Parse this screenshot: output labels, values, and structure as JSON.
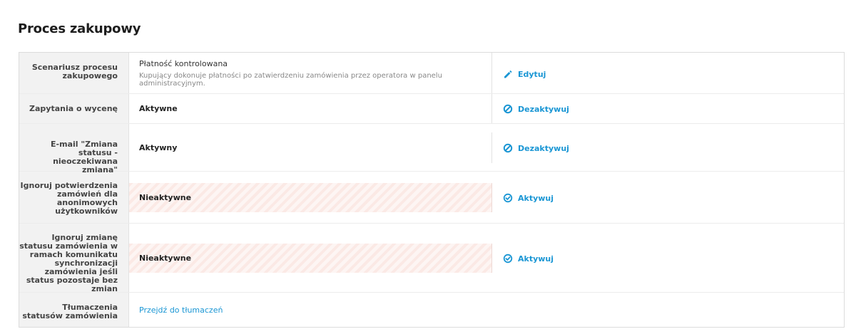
{
  "page": {
    "title": "Proces zakupowy"
  },
  "rows": [
    {
      "label": "Scenariusz procesu zakupowego",
      "value_title": "Płatność kontrolowana",
      "value_desc": "Kupujący dokonuje płatności po zatwierdzeniu zamówienia przez operatora w panelu administracyjnym.",
      "action_label": "Edytuj",
      "action_icon": "pencil-icon"
    },
    {
      "label": "Zapytania o wycenę",
      "value": "Aktywne",
      "action_label": "Dezaktywuj",
      "action_icon": "block-icon"
    },
    {
      "label": "E-mail \"Zmiana statusu - nieoczekiwana zmiana\"",
      "value": "Aktywny",
      "action_label": "Dezaktywuj",
      "action_icon": "block-icon"
    },
    {
      "label": "Ignoruj potwierdzenia zamówień dla anonimowych użytkowników",
      "value": "Nieaktywne",
      "action_label": "Aktywuj",
      "action_icon": "check-circle-icon"
    },
    {
      "label": "Ignoruj zmianę statusu zamówienia w ramach komunikatu synchronizacji zamówienia jeśli status pozostaje bez zmian",
      "value": "Nieaktywne",
      "action_label": "Aktywuj",
      "action_icon": "check-circle-icon"
    },
    {
      "label": "Tłumaczenia statusów zamówienia",
      "link_text": "Przejdź do tłumaczeń"
    }
  ],
  "colors": {
    "accent": "#1a96d4",
    "label_column_bg": "#f2f2f2",
    "inactive_stripe": "#fbe9e5"
  }
}
